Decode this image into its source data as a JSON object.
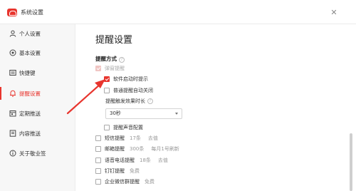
{
  "window": {
    "title": "系统设置",
    "close_symbol": "✕"
  },
  "sidebar": {
    "items": [
      {
        "label": "个人设置",
        "icon": "user-icon",
        "active": false
      },
      {
        "label": "基本设置",
        "icon": "settings-circle-icon",
        "active": false
      },
      {
        "label": "快捷键",
        "icon": "keyboard-icon",
        "active": false
      },
      {
        "label": "提醒设置",
        "icon": "bell-icon",
        "active": true
      },
      {
        "label": "定期推送",
        "icon": "calendar-icon",
        "active": false
      },
      {
        "label": "内容推送",
        "icon": "document-icon",
        "active": false
      },
      {
        "label": "关于敬业签",
        "icon": "info-icon",
        "active": false
      }
    ]
  },
  "main": {
    "page_title": "提醒设置",
    "section_label": "提醒方式",
    "help_symbol": "?",
    "options": {
      "popup": {
        "label": "弹窗提醒",
        "checked": true,
        "disabled": true
      },
      "startup": {
        "label": "软件启动时提示",
        "checked": true
      },
      "auto_close": {
        "label": "普通提醒自动关闭",
        "checked": false
      },
      "duration_label": "提醒触发效果时长",
      "duration_value": "30秒",
      "sound": {
        "label": "提醒声音配置",
        "checked": false
      },
      "sms": {
        "label": "短信提醒",
        "extra1": "17条",
        "extra2": "去值"
      },
      "email": {
        "label": "邮箱提醒",
        "extra1": "300条",
        "extra2": "每月1号刷新"
      },
      "voice": {
        "label": "语音电话提醒",
        "extra1": "18条",
        "extra2": "去值"
      },
      "dingtalk": {
        "label": "钉钉提醒",
        "extra1": "免费"
      },
      "wecom": {
        "label": "企业微信群提醒",
        "extra1": "免费"
      }
    }
  },
  "colors": {
    "accent": "#e8352e",
    "arrow": "#e8352e"
  }
}
